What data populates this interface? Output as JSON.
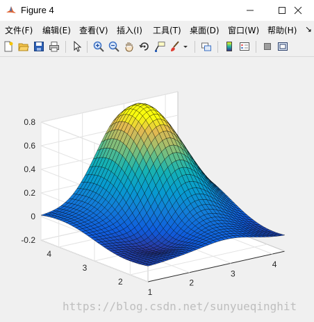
{
  "window": {
    "title": "Figure 4"
  },
  "menu": {
    "items": [
      "文件(F)",
      "编辑(E)",
      "查看(V)",
      "插入(I)",
      "工具(T)",
      "桌面(D)",
      "窗口(W)",
      "帮助(H)"
    ],
    "overflow": "↘"
  },
  "chart_data": {
    "type": "surface",
    "x_ticks": [
      "1",
      "2",
      "3",
      "4"
    ],
    "y_ticks": [
      "2",
      "3",
      "4"
    ],
    "z_ticks": [
      "-0.2",
      "0",
      "0.2",
      "0.4",
      "0.6",
      "0.8"
    ],
    "x_range": [
      1,
      4.3
    ],
    "y_range": [
      1.5,
      4.5
    ],
    "z_range": [
      -0.2,
      0.8
    ],
    "peak": {
      "x": 3.0,
      "y": 4.0,
      "z": 0.8
    },
    "colormap": "parula",
    "grid": true,
    "mesh_edges": "black"
  },
  "watermark": "https://blog.csdn.net/sunyueqinghit"
}
